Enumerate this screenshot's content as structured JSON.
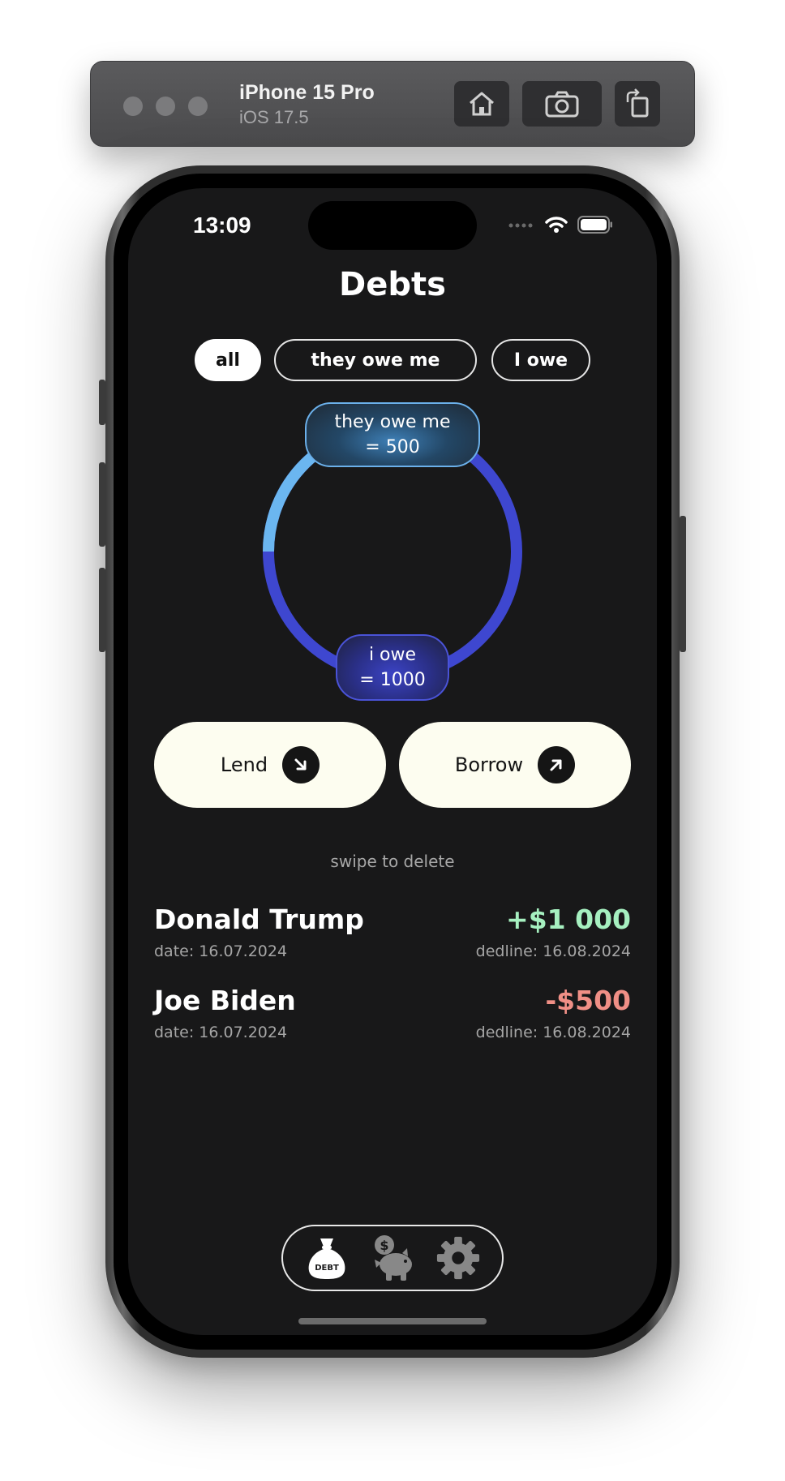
{
  "simulator": {
    "device_name": "iPhone 15 Pro",
    "os_version": "iOS 17.5",
    "buttons": [
      {
        "icon": "home-icon"
      },
      {
        "icon": "camera-icon"
      },
      {
        "icon": "rotate-icon"
      }
    ]
  },
  "status_bar": {
    "time": "13:09",
    "icons": [
      "signal-icon",
      "wifi-icon",
      "battery-icon"
    ]
  },
  "screen": {
    "title": "Debts",
    "filters": [
      {
        "label": "all",
        "selected": true
      },
      {
        "label": "they owe me",
        "selected": false
      },
      {
        "label": "I owe",
        "selected": false
      }
    ],
    "summary": {
      "they_owe_me_label": "they owe me",
      "they_owe_me_value": "= 500",
      "i_owe_label": "i owe",
      "i_owe_value": "= 1000",
      "they_owe_me_amount": 500,
      "i_owe_amount": 1000,
      "colors": {
        "they_owe_me": "#6bb6f0",
        "i_owe": "#3e47d0"
      }
    },
    "actions": [
      {
        "label": "Lend",
        "icon": "arrow-down-right-icon"
      },
      {
        "label": "Borrow",
        "icon": "arrow-up-right-icon"
      }
    ],
    "hint": "swipe to delete",
    "debts": [
      {
        "name": "Donald Trump",
        "date": "date: 16.07.2024",
        "amount": "+$1 000",
        "deadline": "dedline: 16.08.2024",
        "color": "#a6f0c0"
      },
      {
        "name": "Joe Biden",
        "date": "date: 16.07.2024",
        "amount": "-$500",
        "deadline": "dedline: 16.08.2024",
        "color": "#f08f86"
      }
    ],
    "tabbar": [
      {
        "icon": "money-bag-icon",
        "label": "DEBT",
        "active": true
      },
      {
        "icon": "piggy-bank-icon",
        "active": false
      },
      {
        "icon": "gear-icon",
        "active": false
      }
    ]
  }
}
